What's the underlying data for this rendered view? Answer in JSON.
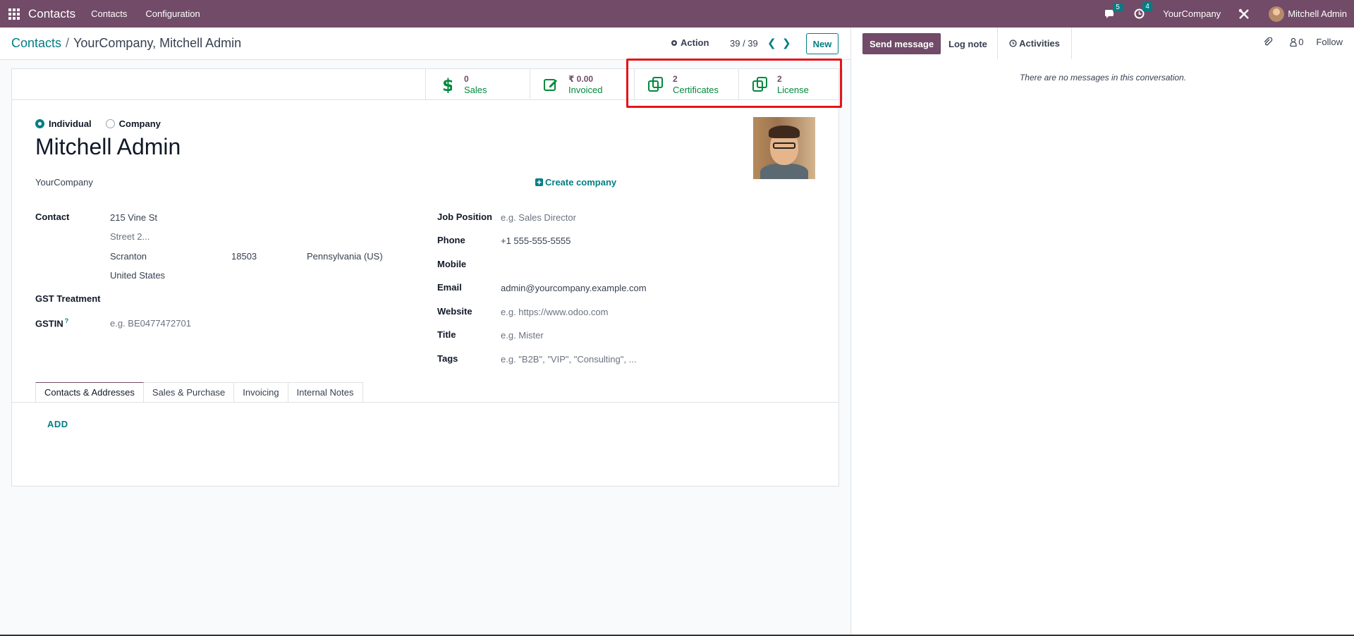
{
  "navbar": {
    "app_name": "Contacts",
    "menus": [
      "Contacts",
      "Configuration"
    ],
    "messages_count": "5",
    "activities_count": "4",
    "company": "YourCompany",
    "user": "Mitchell Admin"
  },
  "control": {
    "breadcrumb_root": "Contacts",
    "breadcrumb_current": "YourCompany, Mitchell Admin",
    "action_label": "Action",
    "pager": "39 / 39",
    "new_label": "New"
  },
  "stats": [
    {
      "value": "0",
      "label": "Sales",
      "icon": "dollar-icon"
    },
    {
      "value": "₹ 0.00",
      "label": "Invoiced",
      "icon": "pencil-square-icon"
    },
    {
      "value": "2",
      "label": "Certificates",
      "icon": "copy-icon"
    },
    {
      "value": "2",
      "label": "License",
      "icon": "copy-icon"
    }
  ],
  "form": {
    "type_individual": "Individual",
    "type_company": "Company",
    "selected_type": "Individual",
    "name": "Mitchell Admin",
    "company": "YourCompany",
    "create_company": "Create company",
    "contact_label": "Contact",
    "street": "215 Vine St",
    "street2_placeholder": "Street 2...",
    "city": "Scranton",
    "zip": "18503",
    "state": "Pennsylvania (US)",
    "country": "United States",
    "gst_treatment_label": "GST Treatment",
    "gstin_label": "GSTIN",
    "gstin_help": "?",
    "gstin_placeholder": "e.g. BE0477472701",
    "job_position_label": "Job Position",
    "job_position_placeholder": "e.g. Sales Director",
    "phone_label": "Phone",
    "phone": "+1 555-555-5555",
    "mobile_label": "Mobile",
    "email_label": "Email",
    "email": "admin@yourcompany.example.com",
    "website_label": "Website",
    "website_placeholder": "e.g. https://www.odoo.com",
    "title_label": "Title",
    "title_placeholder": "e.g. Mister",
    "tags_label": "Tags",
    "tags_placeholder": "e.g. \"B2B\", \"VIP\", \"Consulting\", ...",
    "tabs": [
      "Contacts & Addresses",
      "Sales & Purchase",
      "Invoicing",
      "Internal Notes"
    ],
    "add_label": "ADD"
  },
  "chatter": {
    "send_message": "Send message",
    "log_note": "Log note",
    "activities": "Activities",
    "followers_count": "0",
    "follow": "Follow",
    "empty_text": "There are no messages in this conversation."
  },
  "colors": {
    "brand": "#714b67",
    "accent": "#017e84",
    "stat_label": "#00893d",
    "highlight": "#e5141b"
  }
}
